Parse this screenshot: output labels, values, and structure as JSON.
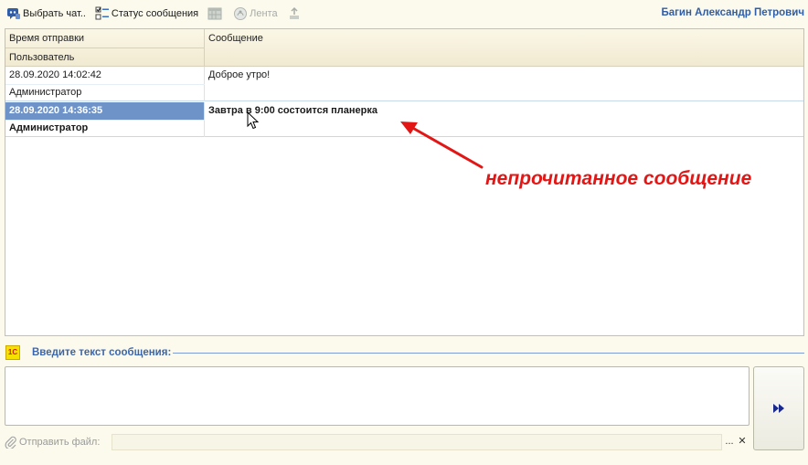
{
  "toolbar": {
    "select_chat_label": "Выбрать чат..",
    "message_status_label": "Статус сообщения",
    "feed_label": "Лента",
    "current_user": "Багин Александр Петрович"
  },
  "grid": {
    "col_time_header": "Время отправки",
    "col_user_header": "Пользователь",
    "col_message_header": "Сообщение",
    "rows": [
      {
        "time": "28.09.2020 14:02:42",
        "user": "Администратор",
        "message": "Доброе утро!"
      },
      {
        "time": "28.09.2020 14:36:35",
        "user": "Администратор",
        "message": "Завтра в 9:00 состоится планерка"
      }
    ]
  },
  "annotation": {
    "text": "непрочитанное сообщение",
    "color": "#e31616"
  },
  "composer": {
    "logo_text": "1С",
    "label": "Введите текст сообщения:",
    "message_value": "",
    "send_icon": "double-arrow-right-icon",
    "attach_label": "Отправить файл:",
    "file_value": "",
    "pick_label": "...",
    "clear_label": "✕"
  },
  "colors": {
    "accent": "#2f5da8",
    "selection": "#6d93c9",
    "background": "#fbfaed"
  }
}
